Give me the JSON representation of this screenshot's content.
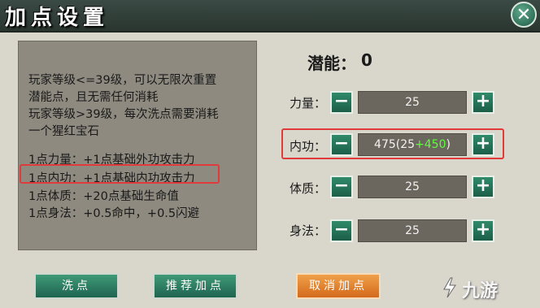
{
  "window": {
    "title": "加点设置",
    "close_glyph": "✕"
  },
  "info": {
    "lines": [
      "玩家等级<=39级，可以无限次重置",
      "潜能点，且无需任何消耗",
      "玩家等级>39级，每次洗点需要消耗",
      "一个猩红宝石",
      "1点力量：+1点基础外功攻击力",
      "1点内功：+1点基础内功攻击力",
      "1点体质：+20点基础生命值",
      "1点身法：+0.5命中，+0.5闪避"
    ]
  },
  "potential": {
    "label": "潜能：",
    "value": "0"
  },
  "stats": [
    {
      "label": "力量：",
      "value": "25",
      "bonus": ""
    },
    {
      "label": "内功：",
      "value": "475(25",
      "bonus": "+450",
      "suffix": ")"
    },
    {
      "label": "体质：",
      "value": "25",
      "bonus": ""
    },
    {
      "label": "身法：",
      "value": "25",
      "bonus": ""
    }
  ],
  "controls": {
    "minus": "−",
    "plus": "+"
  },
  "buttons": {
    "reset": "洗点",
    "recommend": "推荐加点",
    "cancel": "取消加点"
  },
  "watermark": {
    "text": "九游"
  },
  "colors": {
    "accent_green": "#2f8a6a",
    "bonus_green": "#5dff3a",
    "highlight_red": "#e03a3a",
    "cancel_orange": "#e08a36"
  }
}
